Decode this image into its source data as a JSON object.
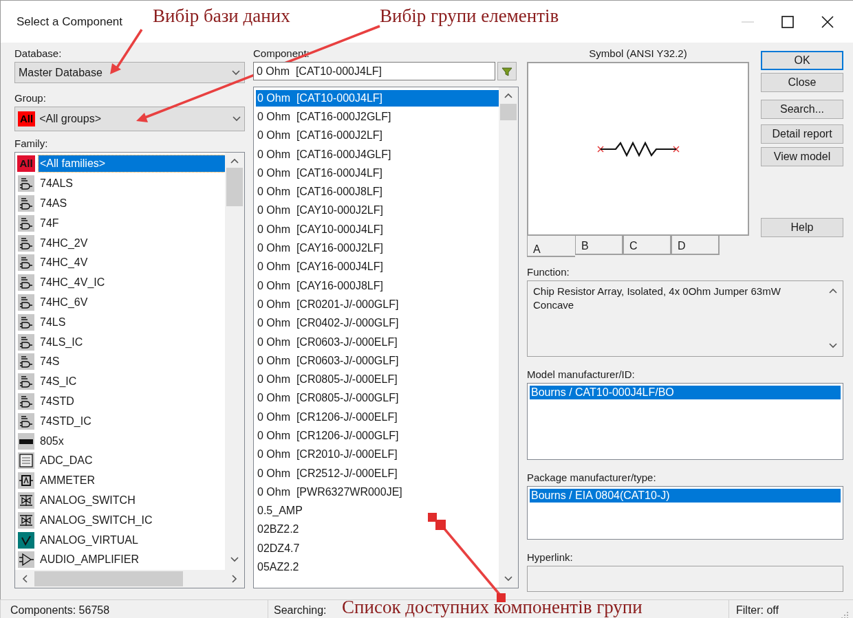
{
  "window": {
    "title": "Select a Component"
  },
  "database": {
    "label": "Database:",
    "value": "Master Database"
  },
  "group": {
    "label": "Group:",
    "badge": "All",
    "value": "<All groups>"
  },
  "family": {
    "label": "Family:",
    "items": [
      {
        "label": "<All families>",
        "kind": "all",
        "badge": "All",
        "selected": true
      },
      {
        "label": "74ALS",
        "kind": "gate",
        "selected": false
      },
      {
        "label": "74AS",
        "kind": "gate",
        "selected": false
      },
      {
        "label": "74F",
        "kind": "gate",
        "selected": false
      },
      {
        "label": "74HC_2V",
        "kind": "gate",
        "selected": false
      },
      {
        "label": "74HC_4V",
        "kind": "gate",
        "selected": false
      },
      {
        "label": "74HC_4V_IC",
        "kind": "gate",
        "selected": false
      },
      {
        "label": "74HC_6V",
        "kind": "gate",
        "selected": false
      },
      {
        "label": "74LS",
        "kind": "gate",
        "selected": false
      },
      {
        "label": "74LS_IC",
        "kind": "gate",
        "selected": false
      },
      {
        "label": "74S",
        "kind": "gate",
        "selected": false
      },
      {
        "label": "74S_IC",
        "kind": "gate",
        "selected": false
      },
      {
        "label": "74STD",
        "kind": "gate",
        "selected": false
      },
      {
        "label": "74STD_IC",
        "kind": "gate",
        "selected": false
      },
      {
        "label": "805x",
        "kind": "chip",
        "selected": false
      },
      {
        "label": "ADC_DAC",
        "kind": "converter",
        "selected": false
      },
      {
        "label": "AMMETER",
        "kind": "meter",
        "selected": false
      },
      {
        "label": "ANALOG_SWITCH",
        "kind": "switch",
        "selected": false
      },
      {
        "label": "ANALOG_SWITCH_IC",
        "kind": "switch",
        "selected": false
      },
      {
        "label": "ANALOG_VIRTUAL",
        "kind": "virtual",
        "selected": false
      },
      {
        "label": "AUDIO_AMPLIFIER",
        "kind": "amplifier",
        "selected": false
      }
    ]
  },
  "component": {
    "label": "Component:",
    "value": "0 Ohm  [CAT10-000J4LF]",
    "items": [
      {
        "label": "0 Ohm  [CAT10-000J4LF]",
        "selected": true
      },
      {
        "label": "0 Ohm  [CAT16-000J2GLF]",
        "selected": false
      },
      {
        "label": "0 Ohm  [CAT16-000J2LF]",
        "selected": false
      },
      {
        "label": "0 Ohm  [CAT16-000J4GLF]",
        "selected": false
      },
      {
        "label": "0 Ohm  [CAT16-000J4LF]",
        "selected": false
      },
      {
        "label": "0 Ohm  [CAT16-000J8LF]",
        "selected": false
      },
      {
        "label": "0 Ohm  [CAY10-000J2LF]",
        "selected": false
      },
      {
        "label": "0 Ohm  [CAY10-000J4LF]",
        "selected": false
      },
      {
        "label": "0 Ohm  [CAY16-000J2LF]",
        "selected": false
      },
      {
        "label": "0 Ohm  [CAY16-000J4LF]",
        "selected": false
      },
      {
        "label": "0 Ohm  [CAY16-000J8LF]",
        "selected": false
      },
      {
        "label": "0 Ohm  [CR0201-J/-000GLF]",
        "selected": false
      },
      {
        "label": "0 Ohm  [CR0402-J/-000GLF]",
        "selected": false
      },
      {
        "label": "0 Ohm  [CR0603-J/-000ELF]",
        "selected": false
      },
      {
        "label": "0 Ohm  [CR0603-J/-000GLF]",
        "selected": false
      },
      {
        "label": "0 Ohm  [CR0805-J/-000ELF]",
        "selected": false
      },
      {
        "label": "0 Ohm  [CR0805-J/-000GLF]",
        "selected": false
      },
      {
        "label": "0 Ohm  [CR1206-J/-000ELF]",
        "selected": false
      },
      {
        "label": "0 Ohm  [CR1206-J/-000GLF]",
        "selected": false
      },
      {
        "label": "0 Ohm  [CR2010-J/-000ELF]",
        "selected": false
      },
      {
        "label": "0 Ohm  [CR2512-J/-000ELF]",
        "selected": false
      },
      {
        "label": "0 Ohm  [PWR6327WR000JE]",
        "selected": false
      },
      {
        "label": "0.5_AMP",
        "selected": false
      },
      {
        "label": "02BZ2.2",
        "selected": false
      },
      {
        "label": "02DZ4.7",
        "selected": false
      },
      {
        "label": "05AZ2.2",
        "selected": false
      }
    ]
  },
  "symbol": {
    "title": "Symbol (ANSI Y32.2)",
    "tabs": [
      {
        "label": "A",
        "selected": true
      },
      {
        "label": "B",
        "selected": false
      },
      {
        "label": "C",
        "selected": false
      },
      {
        "label": "D",
        "selected": false
      }
    ]
  },
  "buttons": [
    {
      "label": "OK",
      "default": true
    },
    {
      "label": "Close",
      "default": false
    },
    {
      "label": "Search...",
      "default": false
    },
    {
      "label": "Detail report",
      "default": false
    },
    {
      "label": "View model",
      "default": false
    },
    {
      "label": "Help",
      "default": false
    }
  ],
  "function": {
    "label": "Function:",
    "value": "Chip Resistor Array, Isolated, 4x 0Ohm Jumper 63mW Concave"
  },
  "model_manufacturer": {
    "label": "Model manufacturer/ID:",
    "items": [
      {
        "label": "Bourns / CAT10-000J4LF/BO",
        "selected": true
      }
    ]
  },
  "package_manufacturer": {
    "label": "Package manufacturer/type:",
    "items": [
      {
        "label": "Bourns / EIA 0804(CAT10-J)",
        "selected": true
      }
    ]
  },
  "hyperlink": {
    "label": "Hyperlink:"
  },
  "status_bar": {
    "components": "Components: 56758",
    "searching": "Searching:",
    "filter": "Filter: off"
  },
  "annotations": [
    {
      "text": "Вибір бази даних"
    },
    {
      "text": "Вибір групи елементів"
    },
    {
      "text": "Список доступних компонентів групи"
    }
  ]
}
